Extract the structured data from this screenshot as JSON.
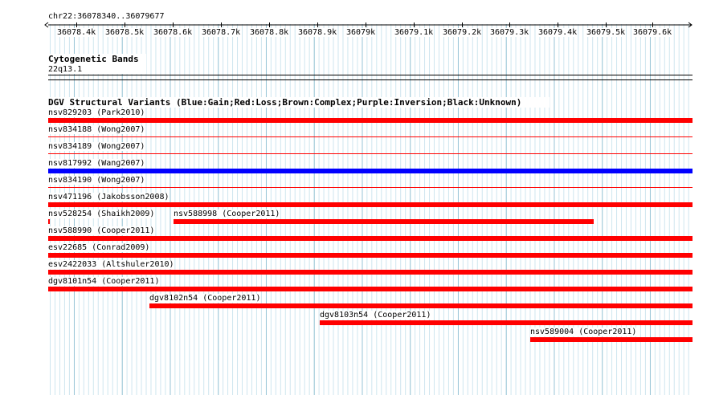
{
  "ruler": {
    "locus": "chr22:36078340..36079677",
    "ticks": [
      "36078.4k",
      "36078.5k",
      "36078.6k",
      "36078.7k",
      "36078.8k",
      "36078.9k",
      "36079k",
      "36079.1k",
      "36079.2k",
      "36079.3k",
      "36079.4k",
      "36079.5k",
      "36079.6k"
    ]
  },
  "cytoband": {
    "title": "Cytogenetic Bands",
    "band": "22q13.1"
  },
  "dgv": {
    "title": "DGV Structural Variants (Blue:Gain;Red:Loss;Brown:Complex;Purple:Inversion;Black:Unknown)",
    "colors": {
      "loss": "#ff0000",
      "gain": "#0000ff"
    },
    "variants": [
      {
        "label": "nsv829203 (Park2010)",
        "type": "loss"
      },
      {
        "label": "nsv834188 (Wong2007)",
        "type": "loss"
      },
      {
        "label": "nsv834189 (Wong2007)",
        "type": "loss"
      },
      {
        "label": "nsv817992 (Wang2007)",
        "type": "gain"
      },
      {
        "label": "nsv834190 (Wong2007)",
        "type": "loss"
      },
      {
        "label": "nsv471196 (Jakobsson2008)",
        "type": "loss"
      },
      {
        "label": "nsv528254 (Shaikh2009)",
        "type": "loss"
      },
      {
        "label": "nsv588998 (Cooper2011)",
        "type": "loss"
      },
      {
        "label": "nsv588990 (Cooper2011)",
        "type": "loss"
      },
      {
        "label": "esv22685 (Conrad2009)",
        "type": "loss"
      },
      {
        "label": "esv2422033 (Altshuler2010)",
        "type": "loss"
      },
      {
        "label": "dgv8101n54 (Cooper2011)",
        "type": "loss"
      },
      {
        "label": "dgv8102n54 (Cooper2011)",
        "type": "loss"
      },
      {
        "label": "dgv8103n54 (Cooper2011)",
        "type": "loss"
      },
      {
        "label": "nsv589004 (Cooper2011)",
        "type": "loss"
      }
    ]
  }
}
